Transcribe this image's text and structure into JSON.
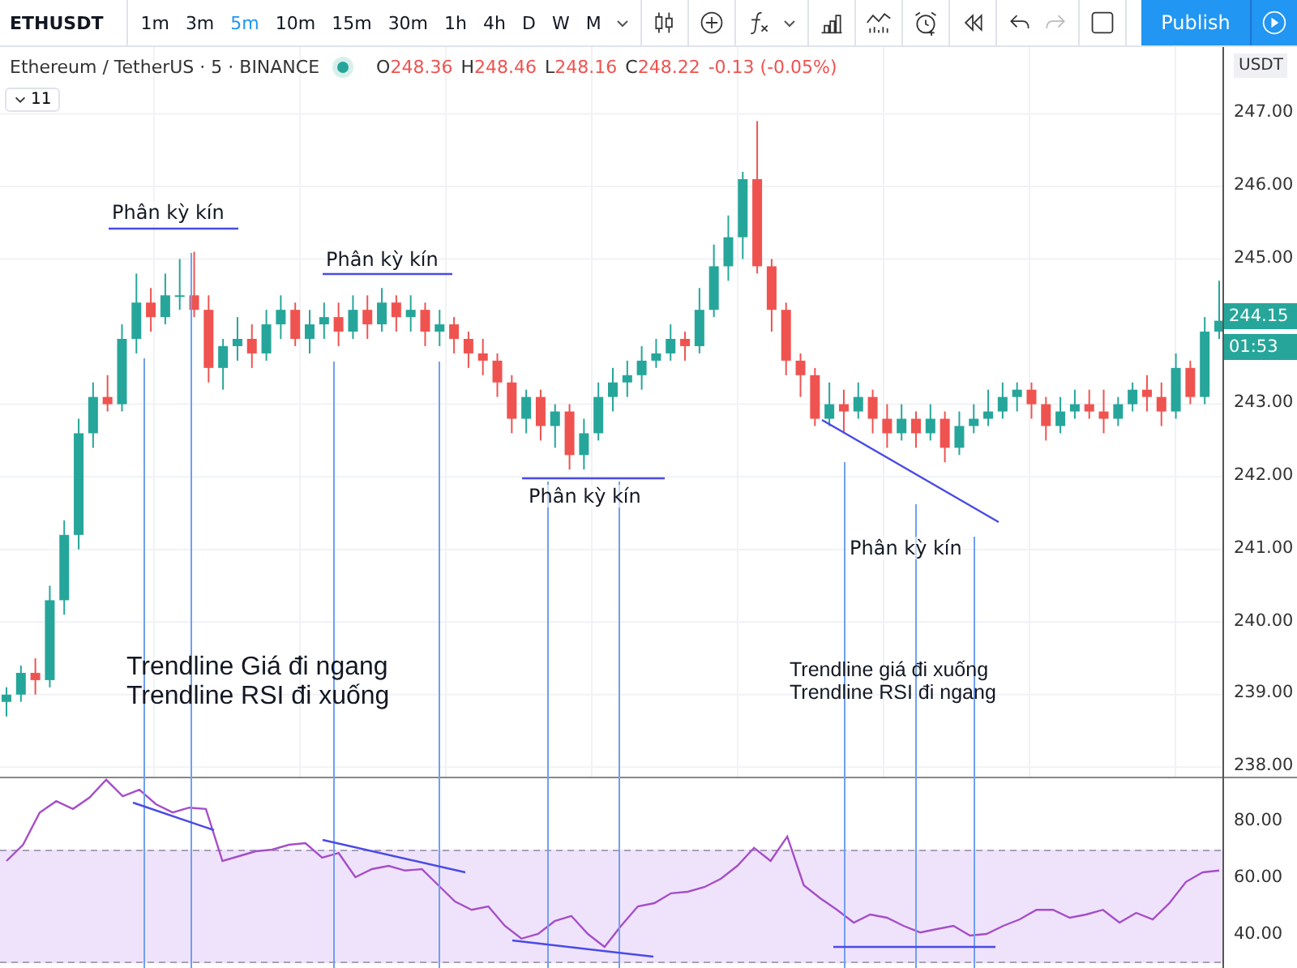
{
  "symbol": "ETHUSDT",
  "intervals": [
    {
      "label": "1m",
      "selected": false
    },
    {
      "label": "3m",
      "selected": false
    },
    {
      "label": "5m",
      "selected": true
    },
    {
      "label": "10m",
      "selected": false
    },
    {
      "label": "15m",
      "selected": false
    },
    {
      "label": "30m",
      "selected": false
    },
    {
      "label": "1h",
      "selected": false
    },
    {
      "label": "4h",
      "selected": false
    },
    {
      "label": "D",
      "selected": false
    },
    {
      "label": "W",
      "selected": false
    },
    {
      "label": "M",
      "selected": false
    }
  ],
  "history": [
    {
      "kind": "undo",
      "disabled": false
    },
    {
      "kind": "redo",
      "disabled": true
    }
  ],
  "publish": "Publish",
  "legend": {
    "title": "Ethereum / TetherUS · 5 · BINANCE",
    "ohlc": [
      {
        "label": "O",
        "value": "248.36"
      },
      {
        "label": "H",
        "value": "248.46"
      },
      {
        "label": "L",
        "value": "248.16"
      },
      {
        "label": "C",
        "value": "248.22"
      }
    ],
    "change": "-0.13 (-0.05%)"
  },
  "indicator_toggle": {
    "label": "11"
  },
  "price_pane": {
    "currency": "USDT",
    "last_price": "244.15",
    "countdown": "01:53",
    "chart_data": {
      "type": "candlestick",
      "grid": true,
      "ylim": [
        237.87,
        247.92
      ],
      "yticks": [
        {
          "value": 247,
          "label": "247.00"
        },
        {
          "value": 246,
          "label": "246.00"
        },
        {
          "value": 245,
          "label": "245.00"
        },
        {
          "value": 243,
          "label": "243.00"
        },
        {
          "value": 242,
          "label": "242.00"
        },
        {
          "value": 241,
          "label": "241.00"
        },
        {
          "value": 240,
          "label": "240.00"
        },
        {
          "value": 239,
          "label": "239.00"
        },
        {
          "value": 238,
          "label": "238.00"
        }
      ],
      "ohlc": [
        [
          238.9,
          239.1,
          238.7,
          239.0
        ],
        [
          239.0,
          239.4,
          238.9,
          239.3
        ],
        [
          239.3,
          239.5,
          239.0,
          239.2
        ],
        [
          239.2,
          240.5,
          239.1,
          240.3
        ],
        [
          240.3,
          241.4,
          240.1,
          241.2
        ],
        [
          241.2,
          242.8,
          241.0,
          242.6
        ],
        [
          242.6,
          243.3,
          242.4,
          243.1
        ],
        [
          243.1,
          243.4,
          242.9,
          243.0
        ],
        [
          243.0,
          244.1,
          242.9,
          243.9
        ],
        [
          243.9,
          244.8,
          243.7,
          244.4
        ],
        [
          244.4,
          244.6,
          244.0,
          244.2
        ],
        [
          244.2,
          244.8,
          244.1,
          244.5
        ],
        [
          244.5,
          245.0,
          244.3,
          244.5
        ],
        [
          244.5,
          245.1,
          244.2,
          244.3
        ],
        [
          244.3,
          244.5,
          243.3,
          243.5
        ],
        [
          243.5,
          243.9,
          243.2,
          243.8
        ],
        [
          243.8,
          244.2,
          243.6,
          243.9
        ],
        [
          243.9,
          244.1,
          243.5,
          243.7
        ],
        [
          243.7,
          244.3,
          243.6,
          244.1
        ],
        [
          244.1,
          244.5,
          243.9,
          244.3
        ],
        [
          244.3,
          244.4,
          243.8,
          243.9
        ],
        [
          243.9,
          244.3,
          243.7,
          244.1
        ],
        [
          244.1,
          244.4,
          243.9,
          244.2
        ],
        [
          244.2,
          244.4,
          243.8,
          244.0
        ],
        [
          244.0,
          244.5,
          243.9,
          244.3
        ],
        [
          244.3,
          244.5,
          243.9,
          244.1
        ],
        [
          244.1,
          244.6,
          244.0,
          244.4
        ],
        [
          244.4,
          244.5,
          244.0,
          244.2
        ],
        [
          244.2,
          244.5,
          244.0,
          244.3
        ],
        [
          244.3,
          244.4,
          243.8,
          244.0
        ],
        [
          244.0,
          244.3,
          243.8,
          244.1
        ],
        [
          244.1,
          244.2,
          243.7,
          243.9
        ],
        [
          243.9,
          244.0,
          243.5,
          243.7
        ],
        [
          243.7,
          243.9,
          243.4,
          243.6
        ],
        [
          243.6,
          243.7,
          243.1,
          243.3
        ],
        [
          243.3,
          243.4,
          242.6,
          242.8
        ],
        [
          242.8,
          243.2,
          242.6,
          243.1
        ],
        [
          243.1,
          243.2,
          242.5,
          242.7
        ],
        [
          242.7,
          243.0,
          242.4,
          242.9
        ],
        [
          242.9,
          243.0,
          242.1,
          242.3
        ],
        [
          242.3,
          242.8,
          242.1,
          242.6
        ],
        [
          242.6,
          243.3,
          242.5,
          243.1
        ],
        [
          243.1,
          243.5,
          242.9,
          243.3
        ],
        [
          243.3,
          243.6,
          243.1,
          243.4
        ],
        [
          243.4,
          243.8,
          243.2,
          243.6
        ],
        [
          243.6,
          243.9,
          243.5,
          243.7
        ],
        [
          243.7,
          244.1,
          243.6,
          243.9
        ],
        [
          243.9,
          244.0,
          243.6,
          243.8
        ],
        [
          243.8,
          244.6,
          243.7,
          244.3
        ],
        [
          244.3,
          245.2,
          244.2,
          244.9
        ],
        [
          244.9,
          245.6,
          244.7,
          245.3
        ],
        [
          245.3,
          246.2,
          245.0,
          246.1
        ],
        [
          246.1,
          246.9,
          244.8,
          244.9
        ],
        [
          244.9,
          245.0,
          244.0,
          244.3
        ],
        [
          244.3,
          244.4,
          243.4,
          243.6
        ],
        [
          243.6,
          243.7,
          243.1,
          243.4
        ],
        [
          243.4,
          243.5,
          242.7,
          242.8
        ],
        [
          242.8,
          243.3,
          242.7,
          243.0
        ],
        [
          243.0,
          243.2,
          242.6,
          242.9
        ],
        [
          242.9,
          243.3,
          242.8,
          243.1
        ],
        [
          243.1,
          243.2,
          242.6,
          242.8
        ],
        [
          242.8,
          243.0,
          242.4,
          242.6
        ],
        [
          242.6,
          243.0,
          242.5,
          242.8
        ],
        [
          242.8,
          242.9,
          242.4,
          242.6
        ],
        [
          242.6,
          243.0,
          242.5,
          242.8
        ],
        [
          242.8,
          242.9,
          242.2,
          242.4
        ],
        [
          242.4,
          242.9,
          242.3,
          242.7
        ],
        [
          242.7,
          243.0,
          242.6,
          242.8
        ],
        [
          242.8,
          243.2,
          242.7,
          242.9
        ],
        [
          242.9,
          243.3,
          242.8,
          243.1
        ],
        [
          243.1,
          243.3,
          242.9,
          243.2
        ],
        [
          243.2,
          243.3,
          242.8,
          243.0
        ],
        [
          243.0,
          243.1,
          242.5,
          242.7
        ],
        [
          242.7,
          243.1,
          242.6,
          242.9
        ],
        [
          242.9,
          243.2,
          242.8,
          243.0
        ],
        [
          243.0,
          243.2,
          242.8,
          242.9
        ],
        [
          242.9,
          243.2,
          242.6,
          242.8
        ],
        [
          242.8,
          243.1,
          242.7,
          243.0
        ],
        [
          243.0,
          243.3,
          242.9,
          243.2
        ],
        [
          243.2,
          243.4,
          242.9,
          243.1
        ],
        [
          243.1,
          243.3,
          242.7,
          242.9
        ],
        [
          242.9,
          243.7,
          242.8,
          243.5
        ],
        [
          243.5,
          243.6,
          243.0,
          243.1
        ],
        [
          243.1,
          244.2,
          243.0,
          244.0
        ],
        [
          244.0,
          244.7,
          243.9,
          244.15
        ]
      ]
    }
  },
  "rsi_pane": {
    "chart_data": {
      "type": "line",
      "ylim": [
        28,
        96
      ],
      "yticks": [
        {
          "value": 80,
          "label": "80.00"
        },
        {
          "value": 60,
          "label": "60.00"
        },
        {
          "value": 40,
          "label": "40.00"
        }
      ],
      "series": [
        {
          "color": "#a54ec8",
          "values": [
            66.3,
            72,
            83.4,
            87.4,
            84.6,
            88.6,
            94.9,
            89.1,
            91.4,
            86.3,
            83.4,
            85.1,
            84.6,
            66.3,
            68,
            69.7,
            70.3,
            72,
            72.6,
            67.4,
            69.1,
            60.6,
            63.4,
            64.6,
            62.9,
            63.4,
            57.7,
            52,
            49.1,
            50.3,
            43.4,
            38.9,
            40.6,
            45.1,
            46.9,
            40.6,
            36,
            43.4,
            50.3,
            51.4,
            54.9,
            55.4,
            57.1,
            60,
            64.6,
            70.9,
            66.3,
            74.9,
            57.7,
            53.1,
            49.1,
            44.6,
            47.4,
            46.3,
            43.4,
            41.1,
            42.3,
            43.4,
            40,
            40.6,
            43.4,
            45.7,
            49.1,
            49.1,
            46.3,
            47.4,
            49.1,
            44.6,
            48,
            45.7,
            51.4,
            58.9,
            62.3,
            62.9
          ]
        }
      ]
    }
  },
  "divergence_labels": [
    "Phân kỳ kín",
    "Phân kỳ kín",
    "Phân kỳ kín",
    "Phân kỳ kín"
  ],
  "notes": [
    {
      "lines": [
        "Trendline Giá đi ngang",
        "Trendline RSI đi xuống"
      ]
    },
    {
      "lines": [
        "Trendline giá đi xuống",
        "Trendline RSI đi ngang"
      ]
    }
  ]
}
